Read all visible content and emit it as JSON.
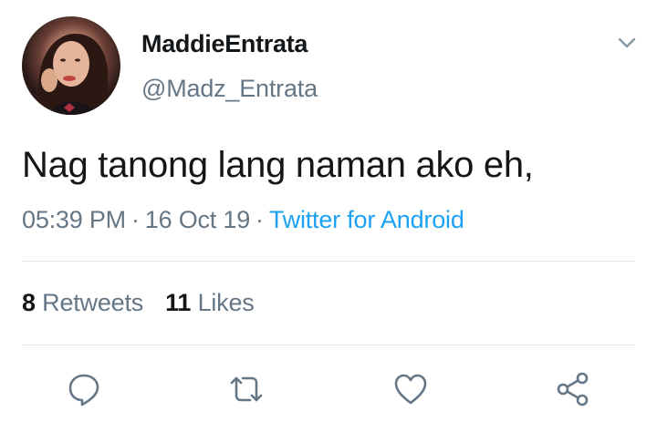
{
  "author": {
    "display_name": "MaddieEntrata",
    "handle": "@Madz_Entrata",
    "avatar_icon": "profile-photo"
  },
  "tweet": {
    "text": "Nag tanong lang naman ako eh,",
    "time": "05:39 PM",
    "date": "16 Oct 19",
    "separator": "·",
    "source": "Twitter for Android"
  },
  "stats": {
    "retweets_count": "8",
    "retweets_label": "Retweets",
    "likes_count": "11",
    "likes_label": "Likes"
  },
  "actions": [
    {
      "name": "reply",
      "icon": "reply-icon"
    },
    {
      "name": "retweet",
      "icon": "retweet-icon"
    },
    {
      "name": "like",
      "icon": "heart-icon"
    },
    {
      "name": "share",
      "icon": "share-icon"
    }
  ],
  "colors": {
    "text_primary": "#14171a",
    "text_secondary": "#657786",
    "link": "#1da1f2",
    "divider": "#e1e8ed"
  }
}
